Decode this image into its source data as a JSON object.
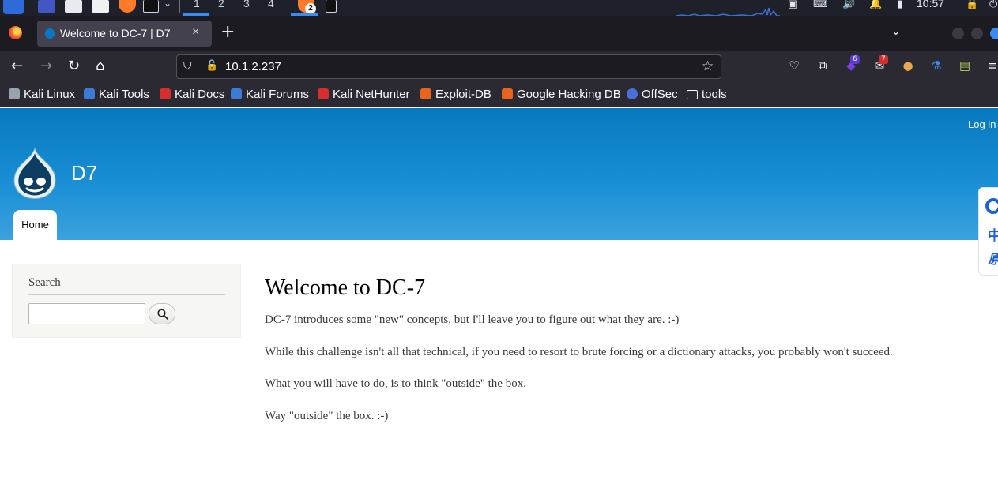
{
  "taskbar": {
    "workspaces": [
      "1",
      "2",
      "3",
      "4"
    ],
    "firefox_window_count": "2",
    "clock": "10:57"
  },
  "browser": {
    "tab": {
      "title": "Welcome to DC-7 | D7",
      "close_glyph": "×"
    },
    "new_tab_glyph": "+",
    "url": "10.1.2.237",
    "extension_badges": {
      "purple": "6",
      "red": "7"
    },
    "bookmarks": [
      {
        "label": "Kali Linux",
        "color": "#9aa3ad"
      },
      {
        "label": "Kali Tools",
        "color": "#3d7bd9"
      },
      {
        "label": "Kali Docs",
        "color": "#d62d2d"
      },
      {
        "label": "Kali Forums",
        "color": "#3d7bd9"
      },
      {
        "label": "Kali NetHunter",
        "color": "#d62d2d"
      },
      {
        "label": "Exploit-DB",
        "color": "#e8631c"
      },
      {
        "label": "Google Hacking DB",
        "color": "#e8631c"
      },
      {
        "label": "OffSec",
        "color": "#4a6fd8"
      },
      {
        "label": "tools",
        "color": "#2b2a33"
      }
    ]
  },
  "site": {
    "login_label": "Log in",
    "name": "D7",
    "nav_home_label": "Home",
    "header_color": "#0779bf"
  },
  "side_widget": {
    "line1": "中",
    "line2": "原"
  },
  "sidebar": {
    "search_heading": "Search",
    "search_value": ""
  },
  "main": {
    "title": "Welcome to DC-7",
    "paragraphs": [
      "DC-7 introduces some \"new\" concepts, but I'll leave you to figure out what they are.  :-)",
      "While this challenge isn't all that technical, if you need to resort to brute forcing or a dictionary attacks, you probably won't succeed.",
      "What you will have to do, is to think \"outside\" the box.",
      "Way \"outside\" the box.  :-)"
    ]
  }
}
